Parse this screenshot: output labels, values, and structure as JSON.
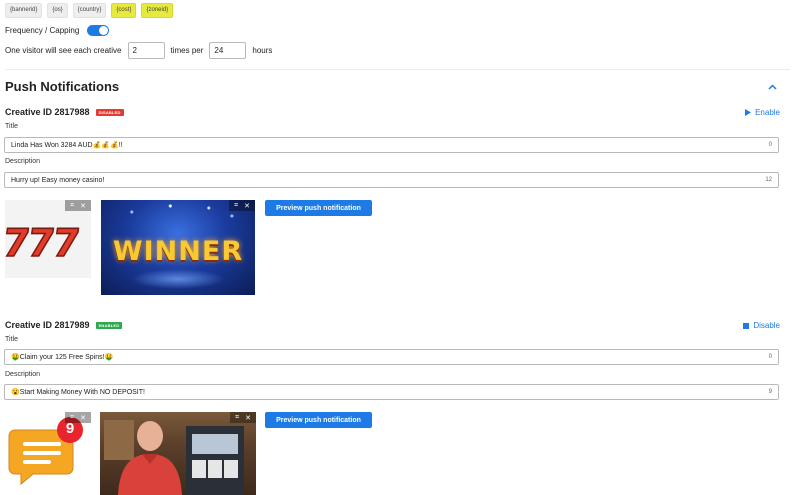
{
  "macros": [
    "{bannerid}",
    "{os}",
    "{country}",
    "{cost}",
    "{zoneid}"
  ],
  "frequency": {
    "label": "Frequency / Capping",
    "sentence_prefix": "One visitor will see each creative",
    "times_value": "2",
    "times_label": "times per",
    "hours_value": "24",
    "hours_label": "hours"
  },
  "section": {
    "title": "Push Notifications",
    "collapse_icon": "chevron-up-icon"
  },
  "creatives": [
    {
      "id_label": "Creative ID 2817988",
      "status_badge": "DISABLED",
      "status_color": "#e53935",
      "action": "Enable",
      "title_label": "Title",
      "title_value": "Linda Has Won 3284 AUD💰💰💰!!",
      "title_count": "0",
      "description_label": "Description",
      "description_value": "Hurry up! Easy money casino!",
      "description_count": "12",
      "preview_button": "Preview push notification",
      "icon_image": "777-slot-icon",
      "main_image_text": "WINNER"
    },
    {
      "id_label": "Creative ID 2817989",
      "status_badge": "ENABLED",
      "status_color": "#2fa84f",
      "action": "Disable",
      "title_label": "Title",
      "title_value": "🤑Claim your 125 Free Spins!🤑",
      "title_count": "0",
      "description_label": "Description",
      "description_value": "😮Start Making Money With NO DEPOSIT!",
      "description_count": "9",
      "preview_button": "Preview push notification",
      "icon_image": "message-notification-icon",
      "icon_badge": "9",
      "main_image_text": ""
    }
  ]
}
